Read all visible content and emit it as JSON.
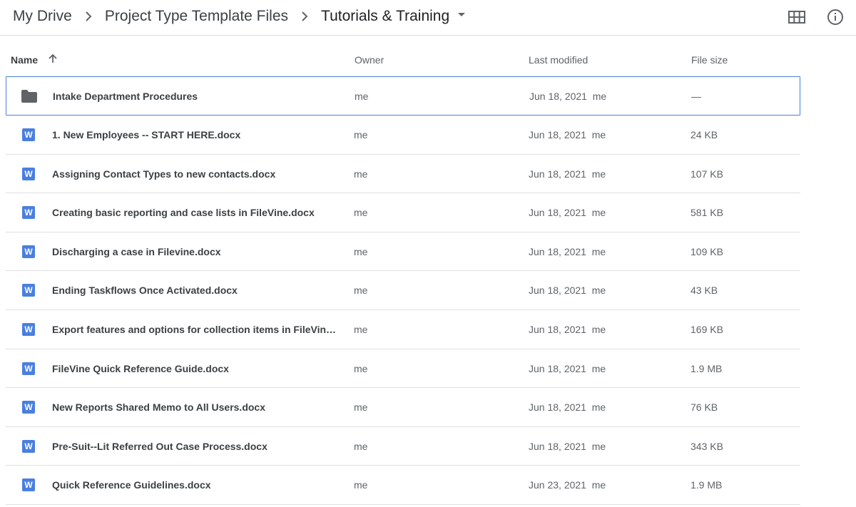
{
  "breadcrumb": {
    "items": [
      "My Drive",
      "Project Type Template Files"
    ],
    "current": "Tutorials & Training"
  },
  "top_icons": {
    "grid": "grid-view-icon",
    "info": "info-icon"
  },
  "columns": {
    "name": "Name",
    "owner": "Owner",
    "modified": "Last modified",
    "size": "File size"
  },
  "files": [
    {
      "type": "folder",
      "name": "Intake Department Procedures",
      "owner": "me",
      "modified": "Jun 18, 2021  me",
      "size": "—",
      "selected": true
    },
    {
      "type": "docx",
      "name": "1. New Employees -- START HERE.docx",
      "owner": "me",
      "modified": "Jun 18, 2021  me",
      "size": "24 KB"
    },
    {
      "type": "docx",
      "name": "Assigning Contact Types to new contacts.docx",
      "owner": "me",
      "modified": "Jun 18, 2021  me",
      "size": "107 KB"
    },
    {
      "type": "docx",
      "name": "Creating basic reporting and case lists in FileVine.docx",
      "owner": "me",
      "modified": "Jun 18, 2021  me",
      "size": "581 KB"
    },
    {
      "type": "docx",
      "name": "Discharging a case in Filevine.docx",
      "owner": "me",
      "modified": "Jun 18, 2021  me",
      "size": "109 KB"
    },
    {
      "type": "docx",
      "name": "Ending Taskflows Once Activated.docx",
      "owner": "me",
      "modified": "Jun 18, 2021  me",
      "size": "43 KB"
    },
    {
      "type": "docx",
      "name": "Export features and options for collection items in FileVine...",
      "owner": "me",
      "modified": "Jun 18, 2021  me",
      "size": "169 KB"
    },
    {
      "type": "docx",
      "name": "FileVine Quick Reference Guide.docx",
      "owner": "me",
      "modified": "Jun 18, 2021  me",
      "size": "1.9 MB"
    },
    {
      "type": "docx",
      "name": "New Reports Shared Memo to All Users.docx",
      "owner": "me",
      "modified": "Jun 18, 2021  me",
      "size": "76 KB"
    },
    {
      "type": "docx",
      "name": "Pre-Suit--Lit Referred Out Case Process.docx",
      "owner": "me",
      "modified": "Jun 18, 2021  me",
      "size": "343 KB"
    },
    {
      "type": "docx",
      "name": "Quick Reference Guidelines.docx",
      "owner": "me",
      "modified": "Jun 23, 2021  me",
      "size": "1.9 MB"
    }
  ],
  "colors": {
    "accent": "#4a7fe0",
    "folder": "#5f6368",
    "word": "#4a7fe0"
  },
  "icons": {
    "docx": "W"
  }
}
